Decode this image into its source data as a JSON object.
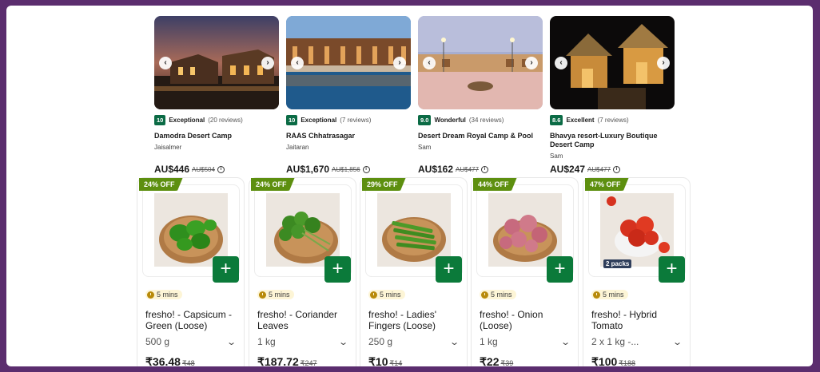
{
  "hotels": [
    {
      "score": "10",
      "label": "Exceptional",
      "reviews": "(20 reviews)",
      "name": "Damodra Desert Camp",
      "location": "Jaisalmer",
      "price": "AU$446",
      "old_price": "AU$504"
    },
    {
      "score": "10",
      "label": "Exceptional",
      "reviews": "(7 reviews)",
      "name": "RAAS Chhatrasagar",
      "location": "Jaitaran",
      "price": "AU$1,670",
      "old_price": "AU$1,856"
    },
    {
      "score": "9.0",
      "label": "Wonderful",
      "reviews": "(34 reviews)",
      "name": "Desert Dream Royal Camp & Pool",
      "location": "Sam",
      "price": "AU$162",
      "old_price": "AU$477"
    },
    {
      "score": "8.6",
      "label": "Excellent",
      "reviews": "(7 reviews)",
      "name": "Bhavya resort-Luxury Boutique Desert Camp",
      "location": "Sam",
      "price": "AU$247",
      "old_price": "AU$477"
    }
  ],
  "products": [
    {
      "discount": "24% OFF",
      "eta": "5 mins",
      "title": "fresho! - Capsicum - Green (Loose)",
      "qty": "500 g",
      "price": "₹36.48",
      "old_price": "₹48"
    },
    {
      "discount": "24% OFF",
      "eta": "5 mins",
      "title": "fresho! - Coriander Leaves",
      "qty": "1 kg",
      "price": "₹187.72",
      "old_price": "₹247"
    },
    {
      "discount": "29% OFF",
      "eta": "5 mins",
      "title": "fresho! - Ladies' Fingers (Loose)",
      "qty": "250 g",
      "price": "₹10",
      "old_price": "₹14"
    },
    {
      "discount": "44% OFF",
      "eta": "5 mins",
      "title": "fresho! - Onion (Loose)",
      "qty": "1 kg",
      "price": "₹22",
      "old_price": "₹39"
    },
    {
      "discount": "47% OFF",
      "eta": "5 mins",
      "title": "fresho! - Hybrid Tomato",
      "qty": "2 x 1 kg -...",
      "price": "₹100",
      "old_price": "₹188",
      "badge": "2 packs"
    }
  ],
  "icons": {
    "prev": "chevron-left-icon",
    "next": "chevron-right-icon",
    "info": "info-icon",
    "add": "plus-icon",
    "clock": "clock-icon",
    "dropdown": "chevron-down-icon"
  },
  "colors": {
    "score_green": "#0b6b45",
    "discount_green": "#5d8f0f",
    "add_green": "#0b7a3a",
    "frame": "#5b2d6e"
  }
}
